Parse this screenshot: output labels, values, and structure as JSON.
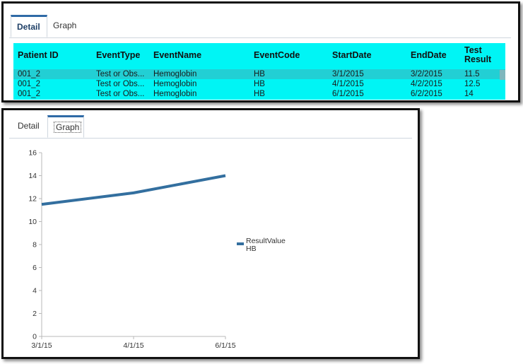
{
  "detail_panel": {
    "tabs": [
      {
        "label": "Detail",
        "active": true
      },
      {
        "label": "Graph",
        "active": false
      }
    ],
    "table": {
      "columns": [
        "Patient ID",
        "EventType",
        "EventName",
        "EventCode",
        "StartDate",
        "EndDate",
        "Test Result"
      ],
      "rows": [
        {
          "patient_id": "001_2",
          "event_type": "Test or Obs...",
          "event_name": "Hemoglobin",
          "event_code": "HB",
          "start_date": "3/1/2015",
          "end_date": "3/2/2015",
          "test_result": "11.5",
          "selected": true
        },
        {
          "patient_id": "001_2",
          "event_type": "Test or Obs...",
          "event_name": "Hemoglobin",
          "event_code": "HB",
          "start_date": "4/1/2015",
          "end_date": "4/2/2015",
          "test_result": "12.5",
          "selected": false
        },
        {
          "patient_id": "001_2",
          "event_type": "Test or Obs...",
          "event_name": "Hemoglobin",
          "event_code": "HB",
          "start_date": "6/1/2015",
          "end_date": "6/2/2015",
          "test_result": "14",
          "selected": false
        }
      ]
    },
    "colors": {
      "table_bg": "#00f5f5",
      "selected_row": "#22cfd4",
      "tab_accent": "#2f6aa6"
    }
  },
  "graph_panel": {
    "tabs": [
      {
        "label": "Detail",
        "active": false
      },
      {
        "label": "Graph",
        "active": true
      }
    ]
  },
  "chart_data": {
    "type": "line",
    "categories": [
      "3/1/15",
      "4/1/15",
      "6/1/15"
    ],
    "series": [
      {
        "name": "ResultValue HB",
        "values": [
          11.5,
          12.5,
          14
        ],
        "color": "#336f9f"
      }
    ],
    "ylim": [
      0,
      16
    ],
    "yticks": [
      0,
      2,
      4,
      6,
      8,
      10,
      12,
      14,
      16
    ],
    "legend": {
      "line1": "ResultValue",
      "line2": "HB",
      "placement": "right"
    },
    "grid": false
  }
}
